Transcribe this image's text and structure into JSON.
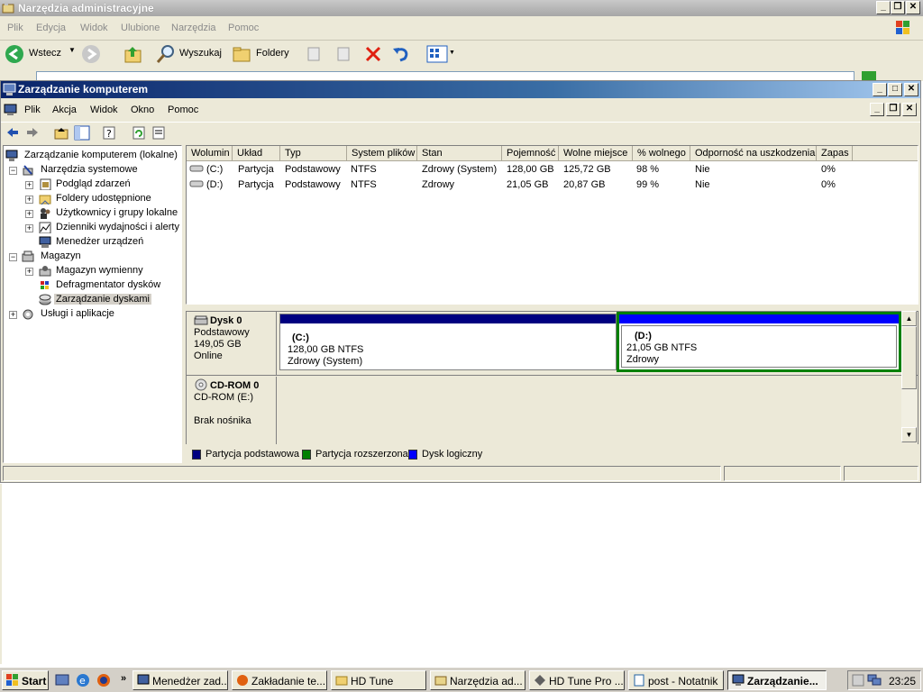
{
  "explorer": {
    "title": "Narzędzia administracyjne",
    "menu": [
      "Plik",
      "Edycja",
      "Widok",
      "Ulubione",
      "Narzędzia",
      "Pomoc"
    ],
    "toolbar": {
      "back_label": "Wstecz",
      "search_label": "Wyszukaj",
      "folders_label": "Foldery"
    }
  },
  "mmc": {
    "title": "Zarządzanie komputerem",
    "menu": [
      "Plik",
      "Akcja",
      "Widok",
      "Okno",
      "Pomoc"
    ],
    "tree": [
      {
        "label": "Zarządzanie komputerem (lokalne)"
      },
      {
        "label": "Narzędzia systemowe"
      },
      {
        "label": "Podgląd zdarzeń"
      },
      {
        "label": "Foldery udostępnione"
      },
      {
        "label": "Użytkownicy i grupy lokalne"
      },
      {
        "label": "Dzienniki wydajności i alerty"
      },
      {
        "label": "Menedżer urządzeń"
      },
      {
        "label": "Magazyn"
      },
      {
        "label": "Magazyn wymienny"
      },
      {
        "label": "Defragmentator dysków"
      },
      {
        "label": "Zarządzanie dyskami"
      },
      {
        "label": "Usługi i aplikacje"
      }
    ],
    "columns": [
      "Wolumin",
      "Układ",
      "Typ",
      "System plików",
      "Stan",
      "Pojemność",
      "Wolne miejsce",
      "% wolnego",
      "Odporność na uszkodzenia",
      "Zapas"
    ],
    "volumes": [
      [
        "(C:)",
        "Partycja",
        "Podstawowy",
        "NTFS",
        "Zdrowy (System)",
        "128,00 GB",
        "125,72 GB",
        "98 %",
        "Nie",
        "0%"
      ],
      [
        "(D:)",
        "Partycja",
        "Podstawowy",
        "NTFS",
        "Zdrowy",
        "21,05 GB",
        "20,87 GB",
        "99 %",
        "Nie",
        "0%"
      ]
    ],
    "disks": {
      "disk0": {
        "name": "Dysk 0",
        "type": "Podstawowy",
        "size": "149,05 GB",
        "status": "Online",
        "c": {
          "label": "(C:)",
          "size": "128,00 GB NTFS",
          "status": "Zdrowy (System)"
        },
        "d": {
          "label": "(D:)",
          "size": "21,05 GB NTFS",
          "status": "Zdrowy"
        }
      },
      "cdrom": {
        "name": "CD-ROM 0",
        "type": "CD-ROM (E:)",
        "status": "Brak nośnika"
      }
    },
    "legend": [
      "Partycja podstawowa",
      "Partycja rozszerzona",
      "Dysk logiczny"
    ],
    "colors": {
      "primary": "#000080",
      "extended": "#008000",
      "logical": "#0000ff"
    }
  },
  "taskbar": {
    "start": "Start",
    "tasks": [
      "Menedżer zad...",
      "Zakładanie te...",
      "HD Tune",
      "Narzędzia ad...",
      "HD Tune Pro ...",
      "post - Notatnik",
      "Zarządzanie..."
    ],
    "clock": "23:25"
  }
}
